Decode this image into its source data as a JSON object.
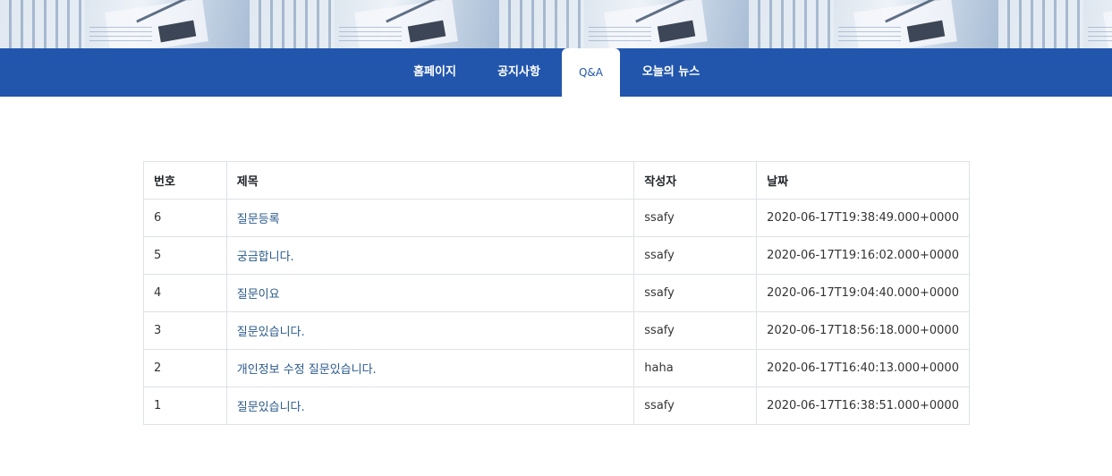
{
  "nav": {
    "items": [
      {
        "label": "홈페이지",
        "active": false
      },
      {
        "label": "공지사항",
        "active": false
      },
      {
        "label": "Q&A",
        "active": true
      },
      {
        "label": "오늘의 뉴스",
        "active": false
      }
    ]
  },
  "table": {
    "headers": {
      "no": "번호",
      "title": "제목",
      "writer": "작성자",
      "date": "날짜"
    },
    "rows": [
      {
        "no": "6",
        "title": "질문등록",
        "writer": "ssafy",
        "date": "2020-06-17T19:38:49.000+0000"
      },
      {
        "no": "5",
        "title": "궁금합니다.",
        "writer": "ssafy",
        "date": "2020-06-17T19:16:02.000+0000"
      },
      {
        "no": "4",
        "title": "질문이요",
        "writer": "ssafy",
        "date": "2020-06-17T19:04:40.000+0000"
      },
      {
        "no": "3",
        "title": "질문있습니다.",
        "writer": "ssafy",
        "date": "2020-06-17T18:56:18.000+0000"
      },
      {
        "no": "2",
        "title": "개인정보 수정 질문있습니다.",
        "writer": "haha",
        "date": "2020-06-17T16:40:13.000+0000"
      },
      {
        "no": "1",
        "title": "질문있습니다.",
        "writer": "ssafy",
        "date": "2020-06-17T16:38:51.000+0000"
      }
    ]
  },
  "colors": {
    "nav_background": "#2256ad",
    "link": "#2a5a8a",
    "border": "#dee2e6"
  }
}
